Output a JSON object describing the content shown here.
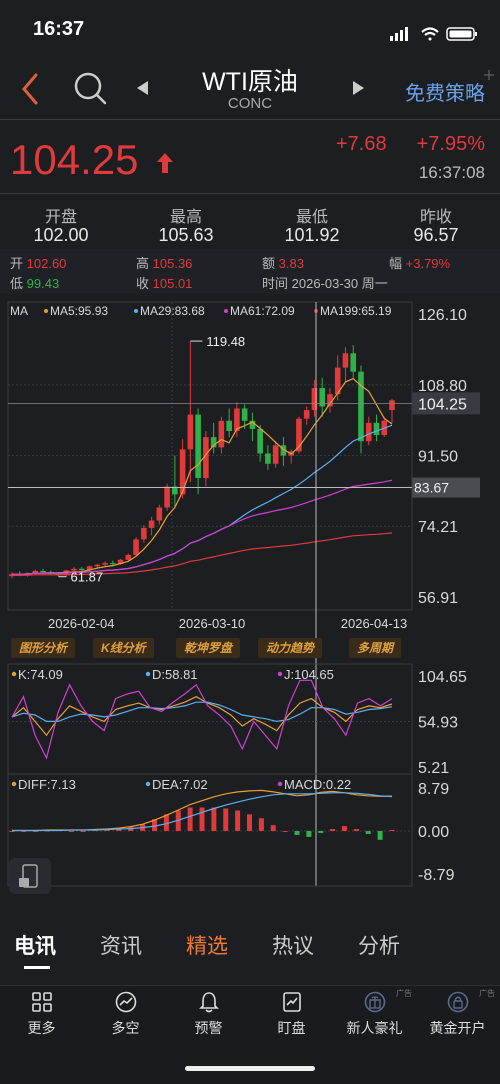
{
  "status": {
    "time": "16:37"
  },
  "header": {
    "title": "WTI原油",
    "subtitle": "CONC",
    "action": "免费策略"
  },
  "quote": {
    "price": "104.25",
    "change": "+7.68",
    "change_pct": "+7.95%",
    "time": "16:37:08"
  },
  "stats": [
    {
      "label": "开盘",
      "value": "102.00"
    },
    {
      "label": "最高",
      "value": "105.63"
    },
    {
      "label": "最低",
      "value": "101.92"
    },
    {
      "label": "昨收",
      "value": "96.57"
    }
  ],
  "candle_info": {
    "open_label": "开",
    "open": "102.60",
    "high_label": "高",
    "high": "105.36",
    "amount_label": "额",
    "amount": "3.83",
    "range_label": "幅",
    "range": "+3.79%",
    "low_label": "低",
    "low": "99.43",
    "close_label": "收",
    "close": "105.01",
    "time_label": "时间",
    "time": "2026-03-30",
    "weekday": "周一"
  },
  "chart_data": [
    {
      "type": "candlestick",
      "indicator": "MA",
      "legend": [
        {
          "name": "MA5:95.93",
          "color": "#e8a030"
        },
        {
          "name": "MA29:83.68",
          "color": "#5ab0f0"
        },
        {
          "name": "MA61:72.09",
          "color": "#d040d0"
        },
        {
          "name": "MA199:65.19",
          "color": "#e03a3a"
        }
      ],
      "y_ticks": [
        "126.10",
        "108.80",
        "91.50",
        "74.21",
        "56.91"
      ],
      "ylim": [
        56.91,
        126.1
      ],
      "x_labels": [
        "2026-02-04",
        "2026-03-10",
        "2026-04-13"
      ],
      "max_label": "119.48",
      "min_label": "61.87",
      "last_price": "104.25",
      "crosshair_value": "83.67",
      "candles": [
        [
          62.0,
          63.0,
          61.5,
          62.5
        ],
        [
          62.5,
          63.2,
          62.0,
          62.3
        ],
        [
          62.3,
          62.9,
          61.9,
          62.8
        ],
        [
          62.8,
          63.6,
          62.5,
          63.3
        ],
        [
          63.3,
          63.8,
          62.8,
          63.0
        ],
        [
          63.0,
          63.4,
          62.4,
          62.6
        ],
        [
          62.6,
          63.0,
          61.87,
          62.3
        ],
        [
          62.3,
          63.5,
          62.0,
          63.4
        ],
        [
          63.4,
          64.2,
          63.0,
          63.8
        ],
        [
          63.8,
          64.3,
          63.2,
          63.5
        ],
        [
          63.5,
          64.6,
          63.3,
          64.4
        ],
        [
          64.4,
          65.0,
          64.0,
          64.8
        ],
        [
          64.8,
          65.6,
          64.2,
          65.2
        ],
        [
          65.2,
          65.8,
          64.6,
          65.0
        ],
        [
          65.0,
          66.2,
          64.8,
          66.0
        ],
        [
          66.0,
          67.5,
          65.8,
          67.2
        ],
        [
          67.2,
          71.5,
          67.0,
          71.0
        ],
        [
          71.0,
          74.5,
          70.2,
          73.8
        ],
        [
          73.8,
          76.5,
          72.0,
          75.6
        ],
        [
          75.6,
          79.5,
          74.6,
          78.8
        ],
        [
          78.8,
          84.6,
          78.0,
          83.9
        ],
        [
          83.9,
          91.5,
          79.0,
          82.0
        ],
        [
          82.0,
          95.5,
          81.0,
          93.0
        ],
        [
          93.0,
          119.48,
          85.0,
          101.5
        ],
        [
          101.5,
          103.0,
          82.0,
          86.0
        ],
        [
          86.0,
          97.5,
          84.0,
          96.0
        ],
        [
          96.0,
          99.5,
          92.0,
          93.5
        ],
        [
          93.5,
          101.0,
          92.0,
          100.0
        ],
        [
          100.0,
          103.0,
          96.0,
          97.5
        ],
        [
          97.5,
          104.5,
          96.0,
          103.0
        ],
        [
          103.0,
          104.0,
          98.0,
          100.0
        ],
        [
          100.0,
          102.0,
          95.0,
          98.0
        ],
        [
          98.0,
          99.0,
          90.0,
          92.0
        ],
        [
          92.0,
          94.0,
          88.0,
          89.5
        ],
        [
          89.5,
          95.0,
          88.5,
          94.0
        ],
        [
          94.0,
          96.0,
          89.0,
          91.5
        ],
        [
          91.5,
          93.0,
          89.5,
          92.5
        ],
        [
          92.5,
          101.0,
          92.0,
          100.5
        ],
        [
          100.5,
          103.5,
          99.0,
          102.6
        ],
        [
          102.6,
          110.0,
          101.0,
          108.0
        ],
        [
          108.0,
          110.5,
          101.0,
          103.5
        ],
        [
          103.5,
          108.0,
          102.0,
          106.5
        ],
        [
          106.5,
          116.0,
          105.0,
          113.0
        ],
        [
          113.0,
          118.0,
          109.5,
          116.5
        ],
        [
          116.5,
          118.5,
          110.5,
          112.0
        ],
        [
          112.0,
          113.5,
          92.0,
          95.0
        ],
        [
          95.0,
          101.0,
          94.0,
          99.5
        ],
        [
          99.5,
          101.5,
          95.0,
          96.5
        ],
        [
          96.5,
          101.0,
          96.0,
          100.0
        ],
        [
          102.6,
          105.36,
          99.43,
          105.01
        ]
      ]
    },
    {
      "type": "line",
      "indicator": "KDJ",
      "legend": [
        {
          "name": "K:74.09",
          "color": "#e8a030"
        },
        {
          "name": "D:58.81",
          "color": "#5ab0f0"
        },
        {
          "name": "J:104.65",
          "color": "#d040d0"
        }
      ],
      "y_ticks": [
        "104.65",
        "54.93",
        "5.21"
      ],
      "ylim": [
        5.21,
        104.65
      ],
      "series": [
        {
          "name": "K",
          "values": [
            60,
            70,
            55,
            40,
            58,
            72,
            66,
            60,
            55,
            68,
            72,
            75,
            70,
            68,
            72,
            76,
            82,
            75,
            70,
            62,
            50,
            58,
            52,
            45,
            62,
            75,
            80,
            70,
            65,
            55,
            68,
            72,
            70,
            74
          ]
        },
        {
          "name": "D",
          "values": [
            60,
            64,
            62,
            55,
            55,
            60,
            63,
            62,
            60,
            62,
            66,
            70,
            70,
            69,
            70,
            72,
            76,
            76,
            73,
            68,
            62,
            60,
            58,
            55,
            57,
            63,
            70,
            70,
            68,
            63,
            65,
            68,
            69,
            71
          ]
        },
        {
          "name": "J",
          "values": [
            60,
            82,
            40,
            15,
            65,
            95,
            72,
            55,
            45,
            80,
            85,
            88,
            70,
            66,
            76,
            85,
            95,
            72,
            62,
            50,
            25,
            55,
            40,
            25,
            72,
            100,
            100,
            70,
            58,
            40,
            75,
            80,
            72,
            80
          ]
        }
      ]
    },
    {
      "type": "bar",
      "indicator": "MACD",
      "legend": [
        {
          "name": "DIFF:7.13",
          "color": "#e8a030"
        },
        {
          "name": "DEA:7.02",
          "color": "#5ab0f0"
        },
        {
          "name": "MACD:0.22",
          "color": "#d040d0"
        }
      ],
      "y_ticks": [
        "8.79",
        "0.00",
        "-8.79"
      ],
      "ylim": [
        -8.79,
        8.79
      ],
      "diff": [
        0.1,
        0.1,
        0.1,
        0.2,
        0.2,
        0.2,
        0.2,
        0.3,
        0.4,
        0.6,
        0.9,
        1.4,
        2.2,
        3.2,
        4.3,
        5.4,
        6.2,
        7.0,
        7.6,
        8.0,
        8.2,
        8.3,
        8.0,
        7.6,
        7.2,
        7.4,
        7.9,
        8.1,
        7.8,
        7.4,
        7.2,
        7.1,
        7.13
      ],
      "dea": [
        0.1,
        0.1,
        0.1,
        0.1,
        0.1,
        0.2,
        0.2,
        0.2,
        0.3,
        0.4,
        0.5,
        0.7,
        1.0,
        1.5,
        2.2,
        3.0,
        3.8,
        4.6,
        5.3,
        5.9,
        6.5,
        7.0,
        7.4,
        7.6,
        7.6,
        7.6,
        7.7,
        7.8,
        7.8,
        7.7,
        7.5,
        7.2,
        7.02
      ],
      "macd": [
        0.0,
        0.0,
        0.0,
        0.1,
        0.2,
        0.0,
        0.0,
        0.2,
        0.2,
        0.4,
        0.8,
        1.4,
        2.4,
        3.4,
        4.2,
        4.8,
        4.8,
        4.8,
        4.6,
        4.2,
        3.4,
        2.6,
        1.2,
        0.0,
        -0.8,
        -1.2,
        -0.4,
        0.4,
        1.0,
        0.4,
        -0.6,
        -1.8,
        0.22
      ]
    }
  ],
  "tools": [
    "图形分析",
    "K线分析",
    "乾坤罗盘",
    "动力趋势",
    "多周期"
  ],
  "news_tabs": [
    {
      "label": "电讯",
      "active": true
    },
    {
      "label": "资讯",
      "active": false
    },
    {
      "label": "精选",
      "active": false,
      "highlight": true
    },
    {
      "label": "热议",
      "active": false
    },
    {
      "label": "分析",
      "active": false
    }
  ],
  "bottom_bar": [
    {
      "label": "更多",
      "icon": "grid-icon"
    },
    {
      "label": "多空",
      "icon": "trend-circle-icon"
    },
    {
      "label": "预警",
      "icon": "bell-icon"
    },
    {
      "label": "盯盘",
      "icon": "chart-card-icon"
    },
    {
      "label": "新人豪礼",
      "icon": "gift-icon",
      "ad": "广告"
    },
    {
      "label": "黄金开户",
      "icon": "lock-icon",
      "ad": "广告"
    }
  ],
  "colors": {
    "up": "#e03a3a",
    "down": "#2fb24a",
    "accent": "#6aa0e8",
    "highlight": "#f0a030"
  }
}
